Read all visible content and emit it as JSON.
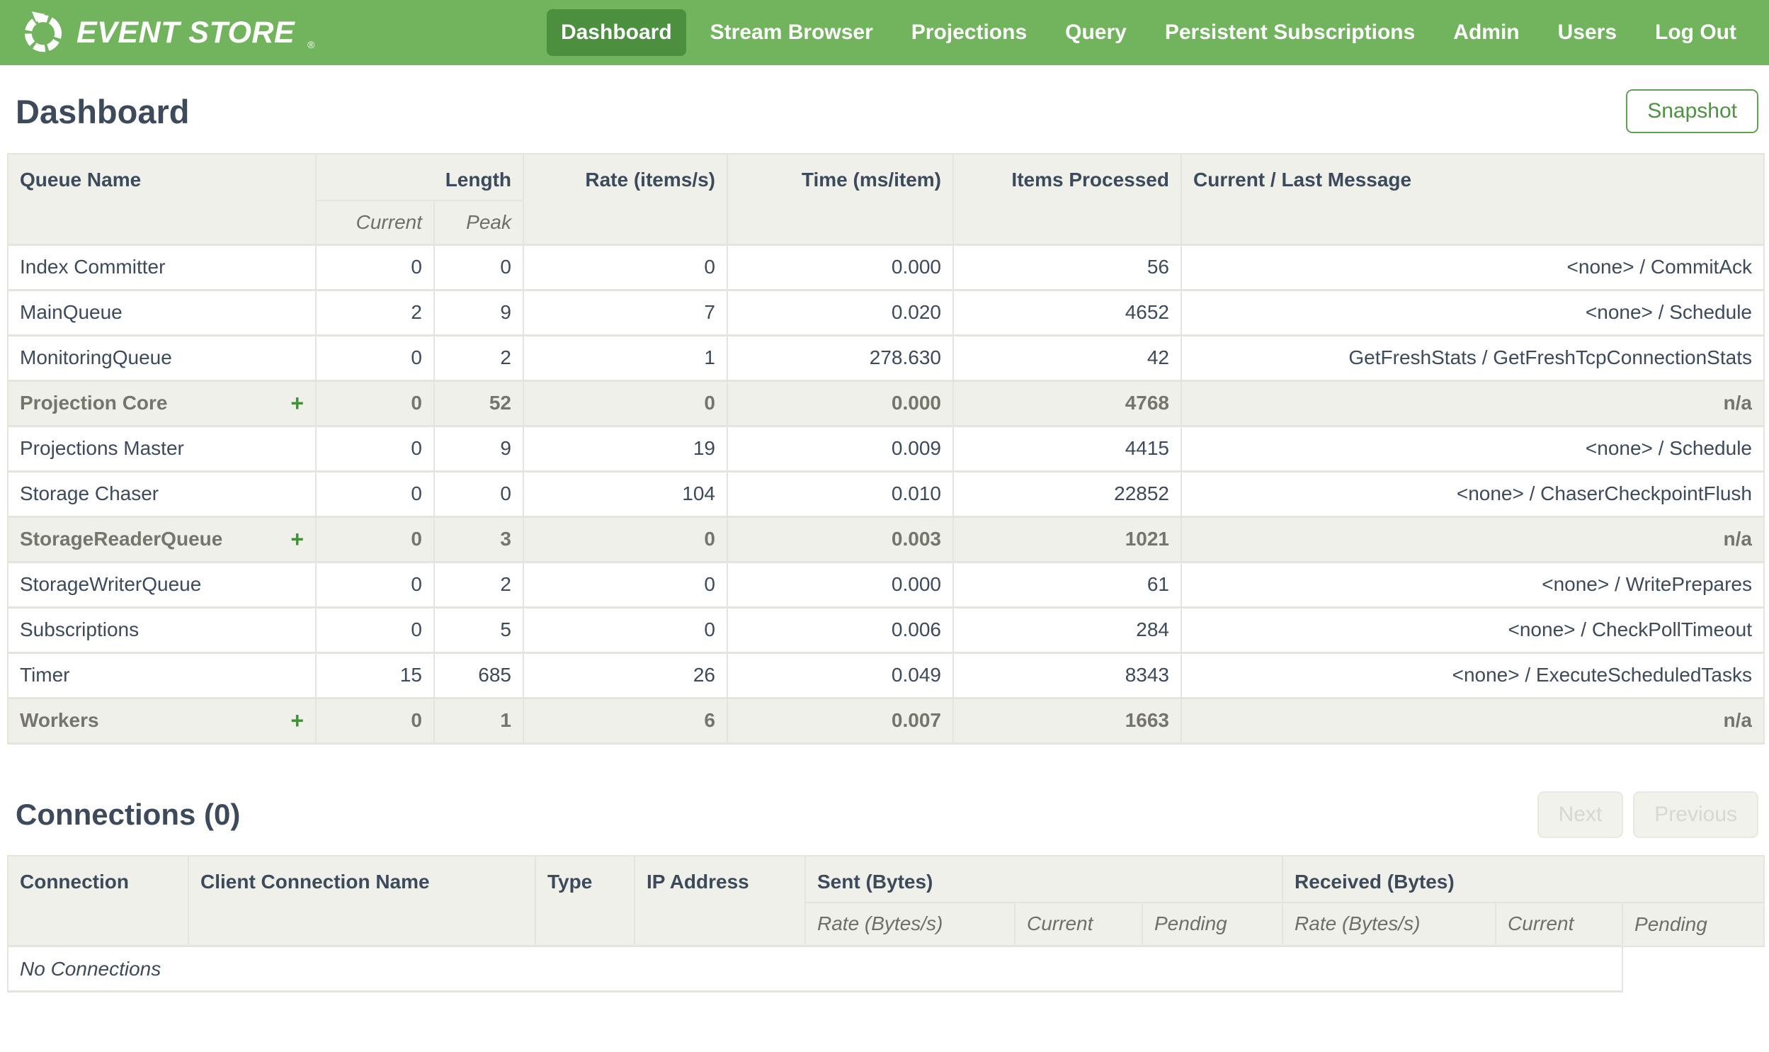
{
  "nav": {
    "brand": "EVENT STORE",
    "reg_mark": "®",
    "items": [
      {
        "label": "Dashboard",
        "active": true
      },
      {
        "label": "Stream Browser",
        "active": false
      },
      {
        "label": "Projections",
        "active": false
      },
      {
        "label": "Query",
        "active": false
      },
      {
        "label": "Persistent Subscriptions",
        "active": false
      },
      {
        "label": "Admin",
        "active": false
      },
      {
        "label": "Users",
        "active": false
      },
      {
        "label": "Log Out",
        "active": false
      }
    ]
  },
  "page": {
    "title": "Dashboard",
    "snapshot_button": "Snapshot"
  },
  "queues": {
    "headers": {
      "queue_name": "Queue Name",
      "length": "Length",
      "current": "Current",
      "peak": "Peak",
      "rate": "Rate (items/s)",
      "time": "Time (ms/item)",
      "items_processed": "Items Processed",
      "message": "Current / Last Message"
    },
    "rows": [
      {
        "name": "Index Committer",
        "group": false,
        "current": "0",
        "peak": "0",
        "rate": "0",
        "time": "0.000",
        "items": "56",
        "message": "<none> / CommitAck"
      },
      {
        "name": "MainQueue",
        "group": false,
        "current": "2",
        "peak": "9",
        "rate": "7",
        "time": "0.020",
        "items": "4652",
        "message": "<none> / Schedule"
      },
      {
        "name": "MonitoringQueue",
        "group": false,
        "current": "0",
        "peak": "2",
        "rate": "1",
        "time": "278.630",
        "items": "42",
        "message": "GetFreshStats / GetFreshTcpConnectionStats"
      },
      {
        "name": "Projection Core",
        "group": true,
        "current": "0",
        "peak": "52",
        "rate": "0",
        "time": "0.000",
        "items": "4768",
        "message": "n/a"
      },
      {
        "name": "Projections Master",
        "group": false,
        "current": "0",
        "peak": "9",
        "rate": "19",
        "time": "0.009",
        "items": "4415",
        "message": "<none> / Schedule"
      },
      {
        "name": "Storage Chaser",
        "group": false,
        "current": "0",
        "peak": "0",
        "rate": "104",
        "time": "0.010",
        "items": "22852",
        "message": "<none> / ChaserCheckpointFlush"
      },
      {
        "name": "StorageReaderQueue",
        "group": true,
        "current": "0",
        "peak": "3",
        "rate": "0",
        "time": "0.003",
        "items": "1021",
        "message": "n/a"
      },
      {
        "name": "StorageWriterQueue",
        "group": false,
        "current": "0",
        "peak": "2",
        "rate": "0",
        "time": "0.000",
        "items": "61",
        "message": "<none> / WritePrepares"
      },
      {
        "name": "Subscriptions",
        "group": false,
        "current": "0",
        "peak": "5",
        "rate": "0",
        "time": "0.006",
        "items": "284",
        "message": "<none> / CheckPollTimeout"
      },
      {
        "name": "Timer",
        "group": false,
        "current": "15",
        "peak": "685",
        "rate": "26",
        "time": "0.049",
        "items": "8343",
        "message": "<none> / ExecuteScheduledTasks"
      },
      {
        "name": "Workers",
        "group": true,
        "current": "0",
        "peak": "1",
        "rate": "6",
        "time": "0.007",
        "items": "1663",
        "message": "n/a"
      }
    ],
    "expand_icon": "+"
  },
  "connections": {
    "title": "Connections (0)",
    "next_button": "Next",
    "previous_button": "Previous",
    "headers": {
      "connection": "Connection",
      "client_name": "Client Connection Name",
      "type": "Type",
      "ip": "IP Address",
      "sent": "Sent (Bytes)",
      "received": "Received (Bytes)",
      "rate": "Rate (Bytes/s)",
      "current": "Current",
      "pending": "Pending"
    },
    "empty_text": "No Connections"
  },
  "colors": {
    "nav_green": "#72b45e",
    "nav_active_green": "#4b8f3f",
    "accent_green": "#4d9340",
    "header_bg": "#eff0e9",
    "border": "#e4e5de",
    "text_dark": "#3d4a5c",
    "group_text": "#75756e",
    "disabled_text": "#d7d8cf"
  }
}
